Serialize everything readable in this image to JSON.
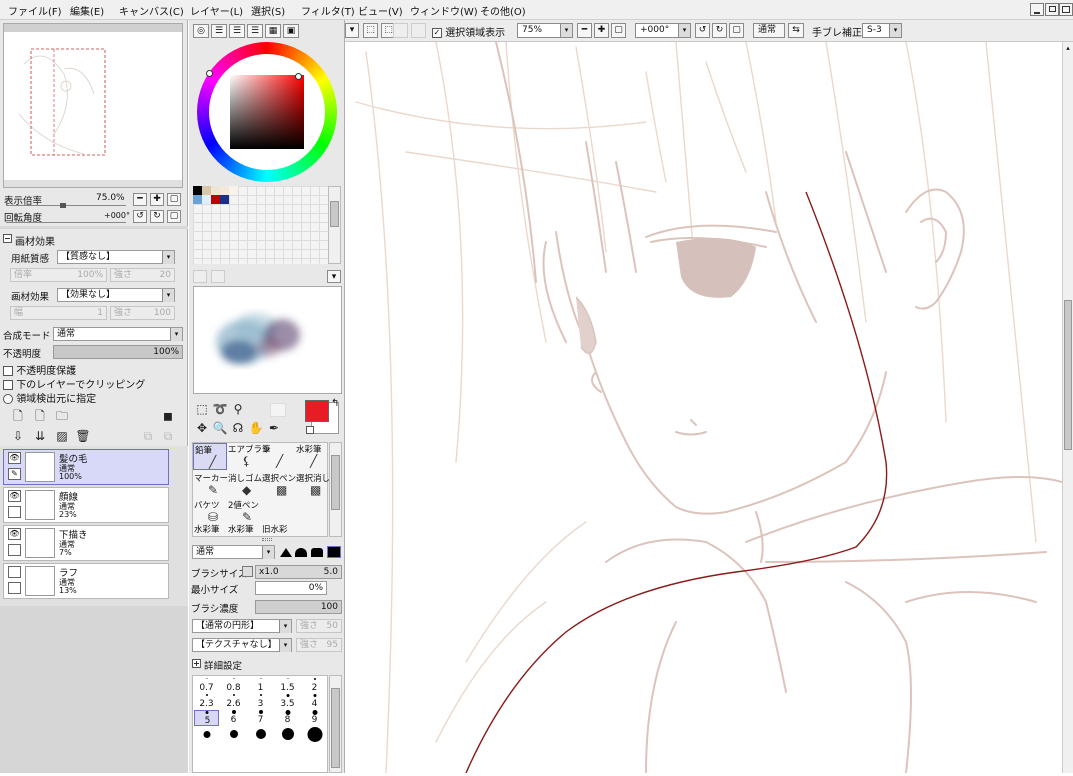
{
  "menu": {
    "items": [
      "ファイル(F)",
      "編集(E)",
      "キャンバス(C)",
      "レイヤー(L)",
      "選択(S)",
      "フィルタ(T)",
      "ビュー(V)",
      "ウィンドウ(W)",
      "その他(O)"
    ]
  },
  "toolbar": {
    "selection_checkbox_label": "選択領域表示",
    "selection_checked": true,
    "zoom_value": "75%",
    "rotation_value": "+000°",
    "blend_value": "通常",
    "stabilizer_label": "手ブレ補正",
    "stabilizer_value": "S-3"
  },
  "navigator": {
    "zoom_label": "表示倍率",
    "zoom_value": "75.0%",
    "rotate_label": "回転角度",
    "rotate_value": "+000°"
  },
  "paper_effect": {
    "header": "画材効果",
    "texture_label": "用紙質感",
    "texture_value": "【質感なし】",
    "texture_scale_label": "倍率",
    "texture_scale_value": "100%",
    "texture_strength_label": "強さ",
    "texture_strength_value": "20",
    "effect_label": "画材効果",
    "effect_value": "【効果なし】",
    "effect_width_label": "幅",
    "effect_width_value": "1",
    "effect_strength_label": "強さ",
    "effect_strength_value": "100"
  },
  "layer_props": {
    "blend_label": "合成モード",
    "blend_value": "通常",
    "opacity_label": "不透明度",
    "opacity_value": "100%",
    "opacity_fraction": 1.0,
    "preserve_opacity_label": "不透明度保護",
    "clipping_label": "下のレイヤーでクリッピング",
    "selection_source_label": "領域検出元に指定"
  },
  "layers": [
    {
      "name": "髪の毛",
      "mode": "通常",
      "opacity": "100%",
      "active": true
    },
    {
      "name": "顔線",
      "mode": "通常",
      "opacity": "23%",
      "active": false
    },
    {
      "name": "下描き",
      "mode": "通常",
      "opacity": "7%",
      "active": false
    },
    {
      "name": "ラフ",
      "mode": "通常",
      "opacity": "13%",
      "active": false
    }
  ],
  "colors": {
    "current": "#e81c24",
    "swatches": [
      "#000000",
      "#d9c6a8",
      "#efe5d6",
      "#f2e9dc",
      "#f7f2ea",
      "#6aa2d8",
      "#e0efff",
      "#c00000",
      "#1a2f8a"
    ],
    "accent": "#7070c8"
  },
  "tools": [
    {
      "label": "鉛筆",
      "icon": "✏",
      "active": true
    },
    {
      "label": "エアブラシ",
      "icon": "✈",
      "active": false
    },
    {
      "label": "筆",
      "icon": "╱",
      "active": false
    },
    {
      "label": "水彩筆",
      "icon": "╱",
      "active": false
    },
    {
      "label": "マーカー",
      "icon": "✎",
      "active": false
    },
    {
      "label": "消しゴム",
      "icon": "◇",
      "active": false
    },
    {
      "label": "選択ペン",
      "icon": "▦",
      "active": false
    },
    {
      "label": "選択消し",
      "icon": "▦",
      "active": false
    },
    {
      "label": "バケツ",
      "icon": "⛁",
      "active": false
    },
    {
      "label": "2値ペン",
      "icon": "✎",
      "active": false
    },
    {
      "label": "水彩筆",
      "icon": "",
      "active": false
    },
    {
      "label": "水彩筆",
      "icon": "",
      "active": false
    },
    {
      "label": "旧水彩",
      "icon": "",
      "active": false
    }
  ],
  "brush": {
    "mode_value": "通常",
    "size_label": "ブラシサイズ",
    "size_mult": "x1.0",
    "size_value": "5.0",
    "min_size_label": "最小サイズ",
    "min_size_value": "0%",
    "density_label": "ブラシ濃度",
    "density_value": "100",
    "shape_value": "【通常の円形】",
    "shape_strength_label": "強さ",
    "shape_strength_value": "50",
    "texture_value": "【テクスチャなし】",
    "texture_strength_label": "強さ",
    "texture_strength_value": "95",
    "details_label": "詳細設定"
  },
  "brush_sizes": [
    {
      "label": "0.7",
      "dot": 1
    },
    {
      "label": "0.8",
      "dot": 1
    },
    {
      "label": "1",
      "dot": 1
    },
    {
      "label": "1.5",
      "dot": 1
    },
    {
      "label": "2",
      "dot": 2
    },
    {
      "label": "2.3",
      "dot": 2
    },
    {
      "label": "2.6",
      "dot": 2
    },
    {
      "label": "3",
      "dot": 2
    },
    {
      "label": "3.5",
      "dot": 3
    },
    {
      "label": "4",
      "dot": 3
    },
    {
      "label": "5",
      "dot": 3
    },
    {
      "label": "6",
      "dot": 4
    },
    {
      "label": "7",
      "dot": 4
    },
    {
      "label": "8",
      "dot": 5
    },
    {
      "label": "9",
      "dot": 5
    },
    {
      "label": "",
      "dot": 7
    },
    {
      "label": "",
      "dot": 8
    },
    {
      "label": "",
      "dot": 10
    },
    {
      "label": "",
      "dot": 12
    },
    {
      "label": "",
      "dot": 15
    }
  ],
  "active_brush_size": "5"
}
